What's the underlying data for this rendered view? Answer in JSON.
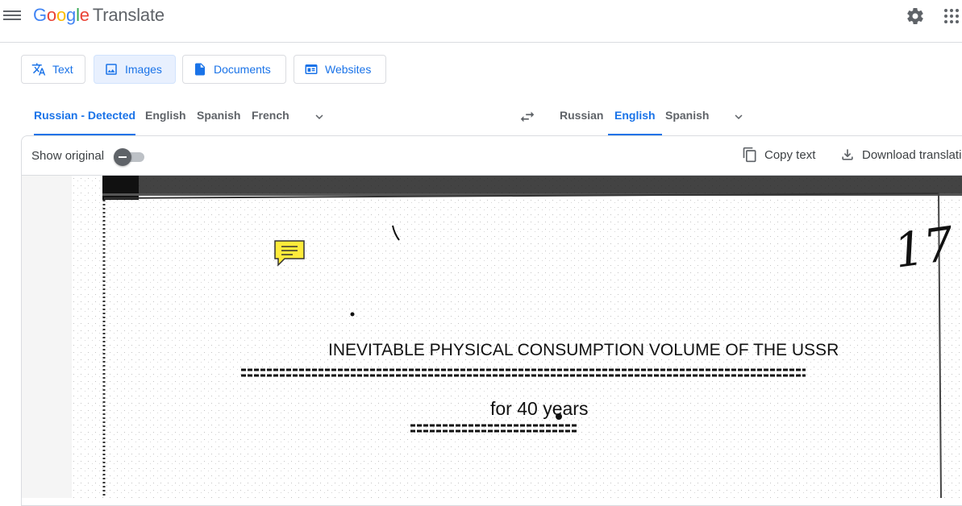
{
  "app": {
    "logo_letters": [
      "G",
      "o",
      "o",
      "g",
      "l",
      "e"
    ],
    "product": "Translate"
  },
  "modes": [
    {
      "label": "Text",
      "icon": "translate-icon",
      "active": false
    },
    {
      "label": "Images",
      "icon": "image-icon",
      "active": true
    },
    {
      "label": "Documents",
      "icon": "document-icon",
      "active": false
    },
    {
      "label": "Websites",
      "icon": "website-icon",
      "active": false
    }
  ],
  "source_langs": [
    "Russian - Detected",
    "English",
    "Spanish",
    "French"
  ],
  "target_langs": [
    "Russian",
    "English",
    "Spanish"
  ],
  "panel": {
    "show_original": "Show original",
    "copy_text": "Copy text",
    "download": "Download translation"
  },
  "document": {
    "title": "INEVITABLE PHYSICAL CONSUMPTION VOLUME OF THE USSR",
    "subtitle": "for 40 years",
    "handwritten": "17"
  },
  "colors": {
    "accent": "#1a73e8",
    "active_bg": "#e8f0fe",
    "comment_yellow": "#ffeb3b"
  }
}
